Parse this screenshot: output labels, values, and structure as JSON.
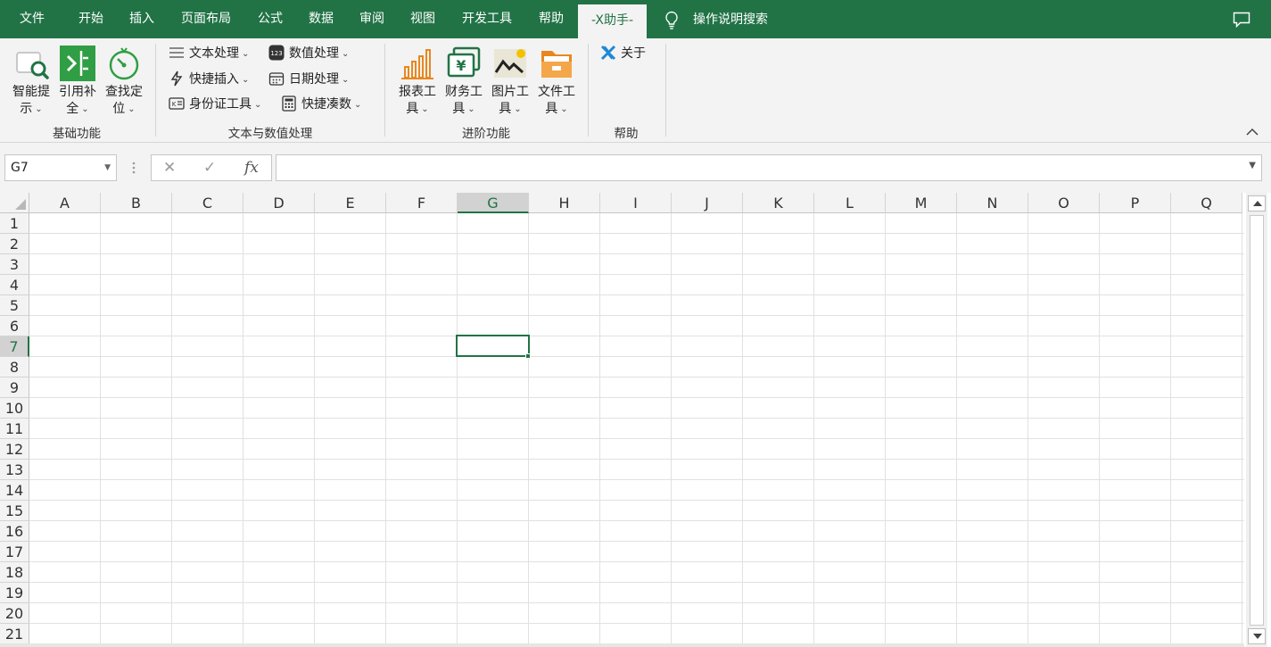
{
  "tabs": [
    "文件",
    "开始",
    "插入",
    "页面布局",
    "公式",
    "数据",
    "审阅",
    "视图",
    "开发工具",
    "帮助",
    "-X助手-"
  ],
  "active_tab": "-X助手-",
  "tell_me": "操作说明搜索",
  "ribbon": {
    "groups": {
      "basic": {
        "label": "基础功能",
        "buttons": [
          {
            "line1": "智能提",
            "line2": "示",
            "icon": "smart-hint-icon"
          },
          {
            "line1": "引用补",
            "line2": "全",
            "icon": "reference-complete-icon"
          },
          {
            "line1": "查找定",
            "line2": "位",
            "icon": "find-locate-icon"
          }
        ]
      },
      "text_num": {
        "label": "文本与数值处理",
        "buttons": [
          {
            "label": "文本处理",
            "icon": "text-process-icon"
          },
          {
            "label": "数值处理",
            "icon": "number-process-icon"
          },
          {
            "label": "快捷插入",
            "icon": "quick-insert-icon"
          },
          {
            "label": "日期处理",
            "icon": "date-process-icon"
          },
          {
            "label": "身份证工具",
            "icon": "id-card-icon"
          },
          {
            "label": "快捷凑数",
            "icon": "calculator-icon"
          }
        ]
      },
      "advanced": {
        "label": "进阶功能",
        "buttons": [
          {
            "line1": "报表工",
            "line2": "具",
            "icon": "report-chart-icon"
          },
          {
            "line1": "财务工",
            "line2": "具",
            "icon": "finance-icon"
          },
          {
            "line1": "图片工",
            "line2": "具",
            "icon": "picture-icon"
          },
          {
            "line1": "文件工",
            "line2": "具",
            "icon": "folder-icon"
          }
        ]
      },
      "help": {
        "label": "帮助",
        "buttons": [
          {
            "label": "关于",
            "icon": "about-icon"
          }
        ]
      }
    }
  },
  "formula_bar": {
    "name_box": "G7",
    "cancel_symbol": "✕",
    "enter_symbol": "✓",
    "fx_symbol": "fx",
    "formula": ""
  },
  "sheet": {
    "columns": [
      "A",
      "B",
      "C",
      "D",
      "E",
      "F",
      "G",
      "H",
      "I",
      "J",
      "K",
      "L",
      "M",
      "N",
      "O",
      "P",
      "Q"
    ],
    "rows": [
      "1",
      "2",
      "3",
      "4",
      "5",
      "6",
      "7",
      "8",
      "9",
      "10",
      "11",
      "12",
      "13",
      "14",
      "15",
      "16",
      "17",
      "18",
      "19",
      "20",
      "21"
    ],
    "active_column": "G",
    "active_row": "7"
  },
  "colors": {
    "brand_green": "#217346",
    "ribbon_bg": "#f3f3f3"
  }
}
